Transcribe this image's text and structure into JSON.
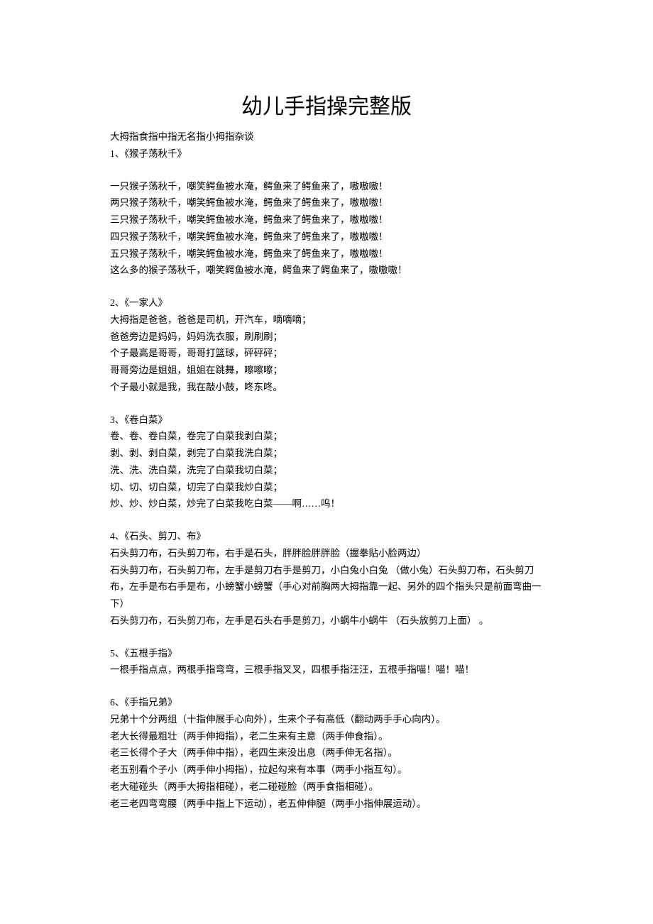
{
  "title": "幼儿手指操完整版",
  "intro": "大拇指食指中指无名指小拇指杂谈",
  "sections": [
    {
      "heading": "1、《猴子荡秋千》",
      "lines": [
        "一只猴子荡秋千，嘲笑鳄鱼被水淹，鳄鱼来了鳄鱼来了，嗷嗷嗷！",
        "两只猴子荡秋千，嘲笑鳄鱼被水淹，鳄鱼来了鳄鱼来了，嗷嗷嗷！",
        "三只猴子荡秋千，嘲笑鳄鱼被水淹，鳄鱼来了鳄鱼来了，嗷嗷嗷！",
        "四只猴子荡秋千，嘲笑鳄鱼被水淹，鳄鱼来了鳄鱼来了，嗷嗷嗷！",
        "五只猴子荡秋千，嘲笑鳄鱼被水淹，鳄鱼来了鳄鱼来了，嗷嗷嗷！",
        "这么多的猴子荡秋千，嘲笑鳄鱼被水淹，鳄鱼来了鳄鱼来了，嗷嗷嗷！"
      ]
    },
    {
      "heading": "2、《一家人》",
      "lines": [
        "大拇指是爸爸，爸爸是司机，开汽车，嘀嘀嘀；",
        "爸爸旁边是妈妈，妈妈洗衣服，刷刷刷；",
        "个子最高是哥哥，哥哥打篮球，砰砰砰；",
        "哥哥旁边是姐姐，姐姐在跳舞，嚓嚓嚓；",
        "个子最小就是我，我在敲小鼓，咚东咚。"
      ]
    },
    {
      "heading": "3、《卷白菜》",
      "lines": [
        "卷、卷、卷白菜，卷完了白菜我剥白菜；",
        "剥、剥、剥白菜，剥完了白菜我洗白菜；",
        "洗、洗、洗白菜，洗完了白菜我切白菜；",
        "切、切、切白菜，切完了白菜我炒白菜；",
        "炒、炒、炒白菜，炒完了白菜我吃白菜——啊……呜！"
      ]
    },
    {
      "heading": "4、《石头、剪刀、布》",
      "lines": [
        "石头剪刀布，石头剪刀布，右手是石头，胖胖脸胖胖脸（握拳贴小脸两边）",
        "石头剪刀布，石头剪刀布，左手是剪刀右手是剪刀，小白兔小白兔 （做小兔）石头剪刀布，石头剪刀布，左手是布右手是布，小螃蟹小螃蟹（手心对前胸两大拇指靠一起、另外的四个指头只是前面弯曲一下）",
        "石头剪刀布，石头剪刀布，左手是石头右手是剪刀，小蜗牛小蜗牛 （石头放剪刀上面） 。"
      ]
    },
    {
      "heading": "5、《五根手指》",
      "lines": [
        "一根手指点点，两根手指弯弯，三根手指叉叉，四根手指汪汪，五根手指喵！喵！喵！"
      ]
    },
    {
      "heading": "6、《手指兄弟》",
      "lines": [
        "兄弟十个分两组（十指伸展手心向外），生来个子有高低（翻动两手手心向内）。",
        "老大长得最粗壮（两手伸拇指），老二生来有主意（两手伸食指）。",
        "老三长得个子大（两手伸中指），老四生来没出息（两手伸无名指）。",
        "老五别看个子小（两手伸小拇指），拉起勾来有本事（两手小指互勾）。",
        "老大碰碰头（两手大拇指相碰），老二碰碰脸（两手食指相碰）。",
        "老三老四弯弯腰（两手中指上下运动），老五伸伸腿（两手小指伸展运动）。"
      ]
    }
  ]
}
